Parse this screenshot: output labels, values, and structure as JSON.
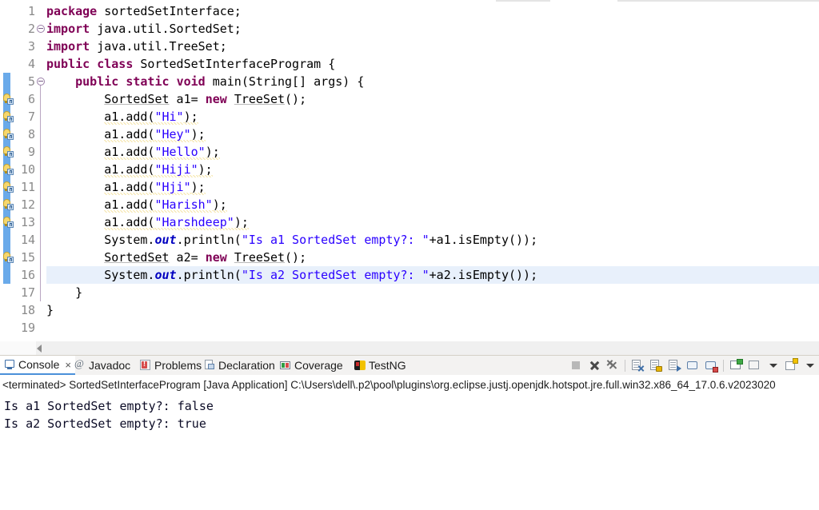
{
  "editor": {
    "lines": [
      {
        "n": "1",
        "indent": 0,
        "warn": false,
        "fold": false,
        "tokens": [
          {
            "t": "package",
            "c": "kw"
          },
          {
            "t": " sortedSetInterface;",
            "c": "plain"
          }
        ]
      },
      {
        "n": "2",
        "indent": 0,
        "warn": false,
        "fold": true,
        "tokens": [
          {
            "t": "import",
            "c": "kw"
          },
          {
            "t": " java.util.SortedSet;",
            "c": "plain"
          }
        ]
      },
      {
        "n": "3",
        "indent": 0,
        "warn": false,
        "fold": false,
        "tokens": [
          {
            "t": "import",
            "c": "kw"
          },
          {
            "t": " java.util.TreeSet;",
            "c": "plain"
          }
        ]
      },
      {
        "n": "4",
        "indent": 0,
        "warn": false,
        "fold": false,
        "tokens": [
          {
            "t": "public",
            "c": "kw"
          },
          {
            "t": " ",
            "c": "plain"
          },
          {
            "t": "class",
            "c": "kw"
          },
          {
            "t": " SortedSetInterfaceProgram {",
            "c": "plain"
          }
        ]
      },
      {
        "n": "5",
        "indent": 0,
        "warn": false,
        "fold": true,
        "tokens": [
          {
            "t": "    ",
            "c": "plain"
          },
          {
            "t": "public",
            "c": "kw"
          },
          {
            "t": " ",
            "c": "plain"
          },
          {
            "t": "static",
            "c": "kw"
          },
          {
            "t": " ",
            "c": "plain"
          },
          {
            "t": "void",
            "c": "kw"
          },
          {
            "t": " main(String[] args) {",
            "c": "plain"
          }
        ]
      },
      {
        "n": "6",
        "indent": 0,
        "warn": true,
        "fold": false,
        "tokens": [
          {
            "t": "        ",
            "c": "plain"
          },
          {
            "t": "SortedSet",
            "c": "unres"
          },
          {
            "t": " a1= ",
            "c": "plain"
          },
          {
            "t": "new",
            "c": "kw"
          },
          {
            "t": " ",
            "c": "plain"
          },
          {
            "t": "TreeSet",
            "c": "unres"
          },
          {
            "t": "();",
            "c": "plain"
          }
        ]
      },
      {
        "n": "7",
        "indent": 0,
        "warn": true,
        "fold": false,
        "tokens": [
          {
            "t": "        ",
            "c": "plain"
          },
          {
            "t": "a1.add(",
            "c": "sq"
          },
          {
            "t": "\"Hi\"",
            "c": "str sq"
          },
          {
            "t": ");",
            "c": "sq"
          }
        ]
      },
      {
        "n": "8",
        "indent": 0,
        "warn": true,
        "fold": false,
        "tokens": [
          {
            "t": "        ",
            "c": "plain"
          },
          {
            "t": "a1.add(",
            "c": "sq"
          },
          {
            "t": "\"Hey\"",
            "c": "str sq"
          },
          {
            "t": ");",
            "c": "sq"
          }
        ]
      },
      {
        "n": "9",
        "indent": 0,
        "warn": true,
        "fold": false,
        "tokens": [
          {
            "t": "        ",
            "c": "plain"
          },
          {
            "t": "a1.add(",
            "c": "sq"
          },
          {
            "t": "\"Hello\"",
            "c": "str sq"
          },
          {
            "t": ");",
            "c": "sq"
          }
        ]
      },
      {
        "n": "10",
        "indent": 0,
        "warn": true,
        "fold": false,
        "tokens": [
          {
            "t": "        ",
            "c": "plain"
          },
          {
            "t": "a1.add(",
            "c": "sq"
          },
          {
            "t": "\"Hiji\"",
            "c": "str sq"
          },
          {
            "t": ");",
            "c": "sq"
          }
        ]
      },
      {
        "n": "11",
        "indent": 0,
        "warn": true,
        "fold": false,
        "tokens": [
          {
            "t": "        ",
            "c": "plain"
          },
          {
            "t": "a1.add(",
            "c": "sq"
          },
          {
            "t": "\"Hji\"",
            "c": "str sq"
          },
          {
            "t": ");",
            "c": "sq"
          }
        ]
      },
      {
        "n": "12",
        "indent": 0,
        "warn": true,
        "fold": false,
        "tokens": [
          {
            "t": "        ",
            "c": "plain"
          },
          {
            "t": "a1.add(",
            "c": "sq"
          },
          {
            "t": "\"Harish\"",
            "c": "str sq"
          },
          {
            "t": ");",
            "c": "sq"
          }
        ]
      },
      {
        "n": "13",
        "indent": 0,
        "warn": true,
        "fold": false,
        "tokens": [
          {
            "t": "        ",
            "c": "plain"
          },
          {
            "t": "a1.add(",
            "c": "sq"
          },
          {
            "t": "\"Harshdeep\"",
            "c": "str sq"
          },
          {
            "t": ");",
            "c": "sq"
          }
        ]
      },
      {
        "n": "14",
        "indent": 0,
        "warn": false,
        "fold": false,
        "tokens": [
          {
            "t": "        System.",
            "c": "plain"
          },
          {
            "t": "out",
            "c": "fld"
          },
          {
            "t": ".println(",
            "c": "plain"
          },
          {
            "t": "\"Is a1 SortedSet empty?: \"",
            "c": "str"
          },
          {
            "t": "+a1.isEmpty());",
            "c": "plain"
          }
        ]
      },
      {
        "n": "15",
        "indent": 0,
        "warn": true,
        "fold": false,
        "tokens": [
          {
            "t": "        ",
            "c": "plain"
          },
          {
            "t": "SortedSet",
            "c": "unres"
          },
          {
            "t": " a2= ",
            "c": "plain"
          },
          {
            "t": "new",
            "c": "kw"
          },
          {
            "t": " ",
            "c": "plain"
          },
          {
            "t": "TreeSet",
            "c": "unres"
          },
          {
            "t": "();",
            "c": "plain"
          }
        ]
      },
      {
        "n": "16",
        "indent": 0,
        "warn": false,
        "fold": false,
        "current": true,
        "tokens": [
          {
            "t": "        System.",
            "c": "plain"
          },
          {
            "t": "out",
            "c": "fld"
          },
          {
            "t": ".println(",
            "c": "plain"
          },
          {
            "t": "\"Is a2 SortedSet empty?: \"",
            "c": "str"
          },
          {
            "t": "+a2.isEmpty());",
            "c": "plain"
          }
        ]
      },
      {
        "n": "17",
        "indent": 0,
        "warn": false,
        "fold": false,
        "tokens": [
          {
            "t": "    }",
            "c": "plain"
          }
        ]
      },
      {
        "n": "18",
        "indent": 0,
        "warn": false,
        "fold": false,
        "tokens": [
          {
            "t": "}",
            "c": "plain"
          }
        ]
      },
      {
        "n": "19",
        "indent": 0,
        "warn": false,
        "fold": false,
        "tokens": []
      }
    ]
  },
  "console": {
    "tabs": [
      {
        "label": "Console",
        "icon": "console-icon",
        "active": true,
        "closable": true,
        "close": "×"
      },
      {
        "label": "Javadoc",
        "icon": "javadoc-icon",
        "active": false,
        "closable": false
      },
      {
        "label": "Problems",
        "icon": "problems-icon",
        "active": false,
        "closable": false
      },
      {
        "label": "Declaration",
        "icon": "declaration-icon",
        "active": false,
        "closable": false
      },
      {
        "label": "Coverage",
        "icon": "coverage-icon",
        "active": false,
        "closable": false
      },
      {
        "label": "TestNG",
        "icon": "testng-icon",
        "active": false,
        "closable": false
      }
    ],
    "toolbar": [
      {
        "name": "terminate-button"
      },
      {
        "name": "remove-launch-button"
      },
      {
        "name": "remove-all-terminated-button"
      },
      {
        "name": "separator-1"
      },
      {
        "name": "clear-console-button"
      },
      {
        "name": "scroll-lock-button"
      },
      {
        "name": "word-wrap-button"
      },
      {
        "name": "show-console-on-output-button"
      },
      {
        "name": "show-console-on-error-button"
      },
      {
        "name": "separator-2"
      },
      {
        "name": "pin-console-button"
      },
      {
        "name": "display-selected-console-button"
      },
      {
        "name": "display-selected-console-dropdown"
      },
      {
        "name": "open-console-button"
      },
      {
        "name": "open-console-dropdown"
      }
    ],
    "terminated_line": "<terminated> SortedSetInterfaceProgram [Java Application] C:\\Users\\dell\\.p2\\pool\\plugins\\org.eclipse.justj.openjdk.hotspot.jre.full.win32.x86_64_17.0.6.v2023020",
    "output": [
      "Is a1 SortedSet empty?: false",
      "Is a2 SortedSet empty?: true"
    ]
  },
  "colors": {
    "keyword": "#7f0055",
    "string": "#2a00ff",
    "field": "#0000c0",
    "line_number": "#8a8a8a",
    "current_line_bg": "#e8f0fb",
    "change_bar": "#6aaaea",
    "warning_underline": "#e2b100",
    "active_tab_underline": "#4a90d9"
  }
}
